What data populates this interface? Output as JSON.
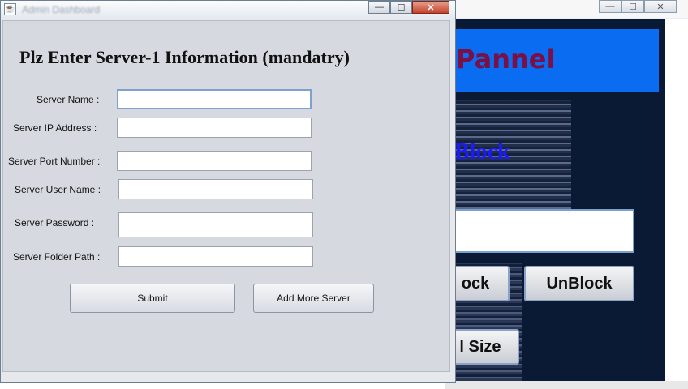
{
  "background_window": {
    "banner_text": "Pannel",
    "logo_text": "Block",
    "block_button": "ock",
    "unblock_button": "UnBlock",
    "size_button": "l Size",
    "min_glyph": "—",
    "max_glyph": "☐",
    "close_glyph": "✕"
  },
  "dialog": {
    "title": "Admin Dashboard",
    "icon_glyph": "☕",
    "min_glyph": "—",
    "max_glyph": "☐",
    "close_glyph": "✕",
    "heading": "Plz Enter Server-1 Information (mandatry)",
    "fields": {
      "server_name": {
        "label": "Server Name :",
        "value": ""
      },
      "server_ip": {
        "label": "Server IP Address :",
        "value": ""
      },
      "server_port": {
        "label": "Server Port Number :",
        "value": ""
      },
      "server_user": {
        "label": "Server User Name :",
        "value": ""
      },
      "server_password": {
        "label": "Server Password :",
        "value": ""
      },
      "server_folder": {
        "label": "Server Folder  Path :",
        "value": ""
      }
    },
    "submit_label": "Submit",
    "add_more_label": "Add More Server"
  }
}
